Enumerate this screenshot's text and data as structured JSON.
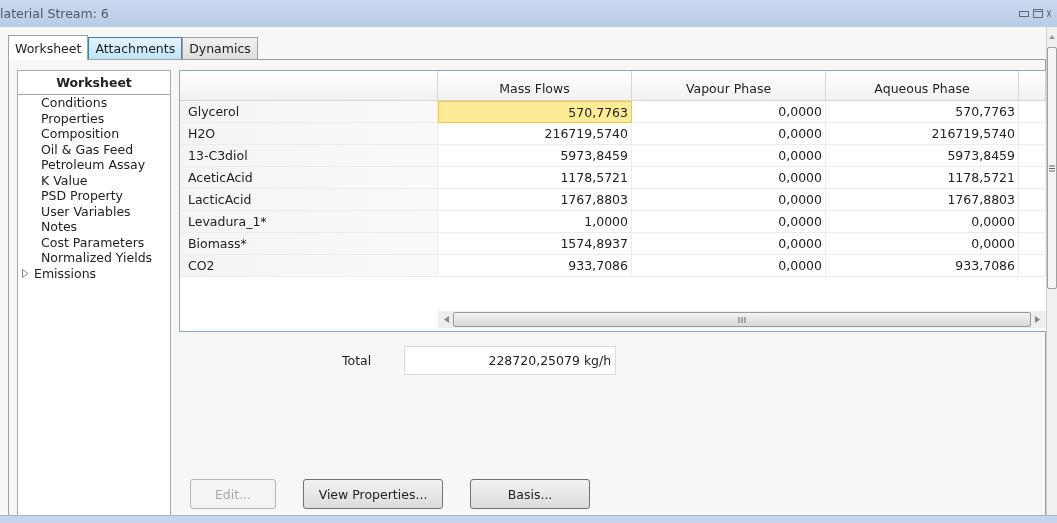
{
  "window": {
    "title": "laterial Stream: 6"
  },
  "tabs": [
    {
      "label": "Worksheet",
      "selected": true,
      "hover": false
    },
    {
      "label": "Attachments",
      "selected": false,
      "hover": true
    },
    {
      "label": "Dynamics",
      "selected": false,
      "hover": false
    }
  ],
  "sidebar": {
    "title": "Worksheet",
    "items": [
      {
        "label": "Conditions",
        "expandable": false
      },
      {
        "label": "Properties",
        "expandable": false
      },
      {
        "label": "Composition",
        "expandable": false
      },
      {
        "label": "Oil & Gas Feed",
        "expandable": false
      },
      {
        "label": "Petroleum Assay",
        "expandable": false
      },
      {
        "label": "K Value",
        "expandable": false
      },
      {
        "label": "PSD Property",
        "expandable": false
      },
      {
        "label": "User Variables",
        "expandable": false
      },
      {
        "label": "Notes",
        "expandable": false
      },
      {
        "label": "Cost Parameters",
        "expandable": false
      },
      {
        "label": "Normalized Yields",
        "expandable": false
      },
      {
        "label": "Emissions",
        "expandable": true
      }
    ]
  },
  "table": {
    "columns": [
      "Mass Flows",
      "Vapour Phase",
      "Aqueous Phase"
    ],
    "rows": [
      {
        "name": "Glycerol",
        "values": [
          "570,7763",
          "0,0000",
          "570,7763"
        ],
        "selected": true
      },
      {
        "name": "H2O",
        "values": [
          "216719,5740",
          "0,0000",
          "216719,5740"
        ],
        "selected": false
      },
      {
        "name": "13-C3diol",
        "values": [
          "5973,8459",
          "0,0000",
          "5973,8459"
        ],
        "selected": false
      },
      {
        "name": "AceticAcid",
        "values": [
          "1178,5721",
          "0,0000",
          "1178,5721"
        ],
        "selected": false
      },
      {
        "name": "LacticAcid",
        "values": [
          "1767,8803",
          "0,0000",
          "1767,8803"
        ],
        "selected": false
      },
      {
        "name": "Levadura_1*",
        "values": [
          "1,0000",
          "0,0000",
          "0,0000"
        ],
        "selected": false
      },
      {
        "name": "Biomass*",
        "values": [
          "1574,8937",
          "0,0000",
          "0,0000"
        ],
        "selected": false
      },
      {
        "name": "CO2",
        "values": [
          "933,7086",
          "0,0000",
          "933,7086"
        ],
        "selected": false
      }
    ]
  },
  "total": {
    "label": "Total",
    "value": "228720,25079 kg/h"
  },
  "buttons": [
    {
      "label": "Edit...",
      "disabled": true
    },
    {
      "label": "View Properties...",
      "disabled": false
    },
    {
      "label": "Basis...",
      "disabled": false
    }
  ]
}
